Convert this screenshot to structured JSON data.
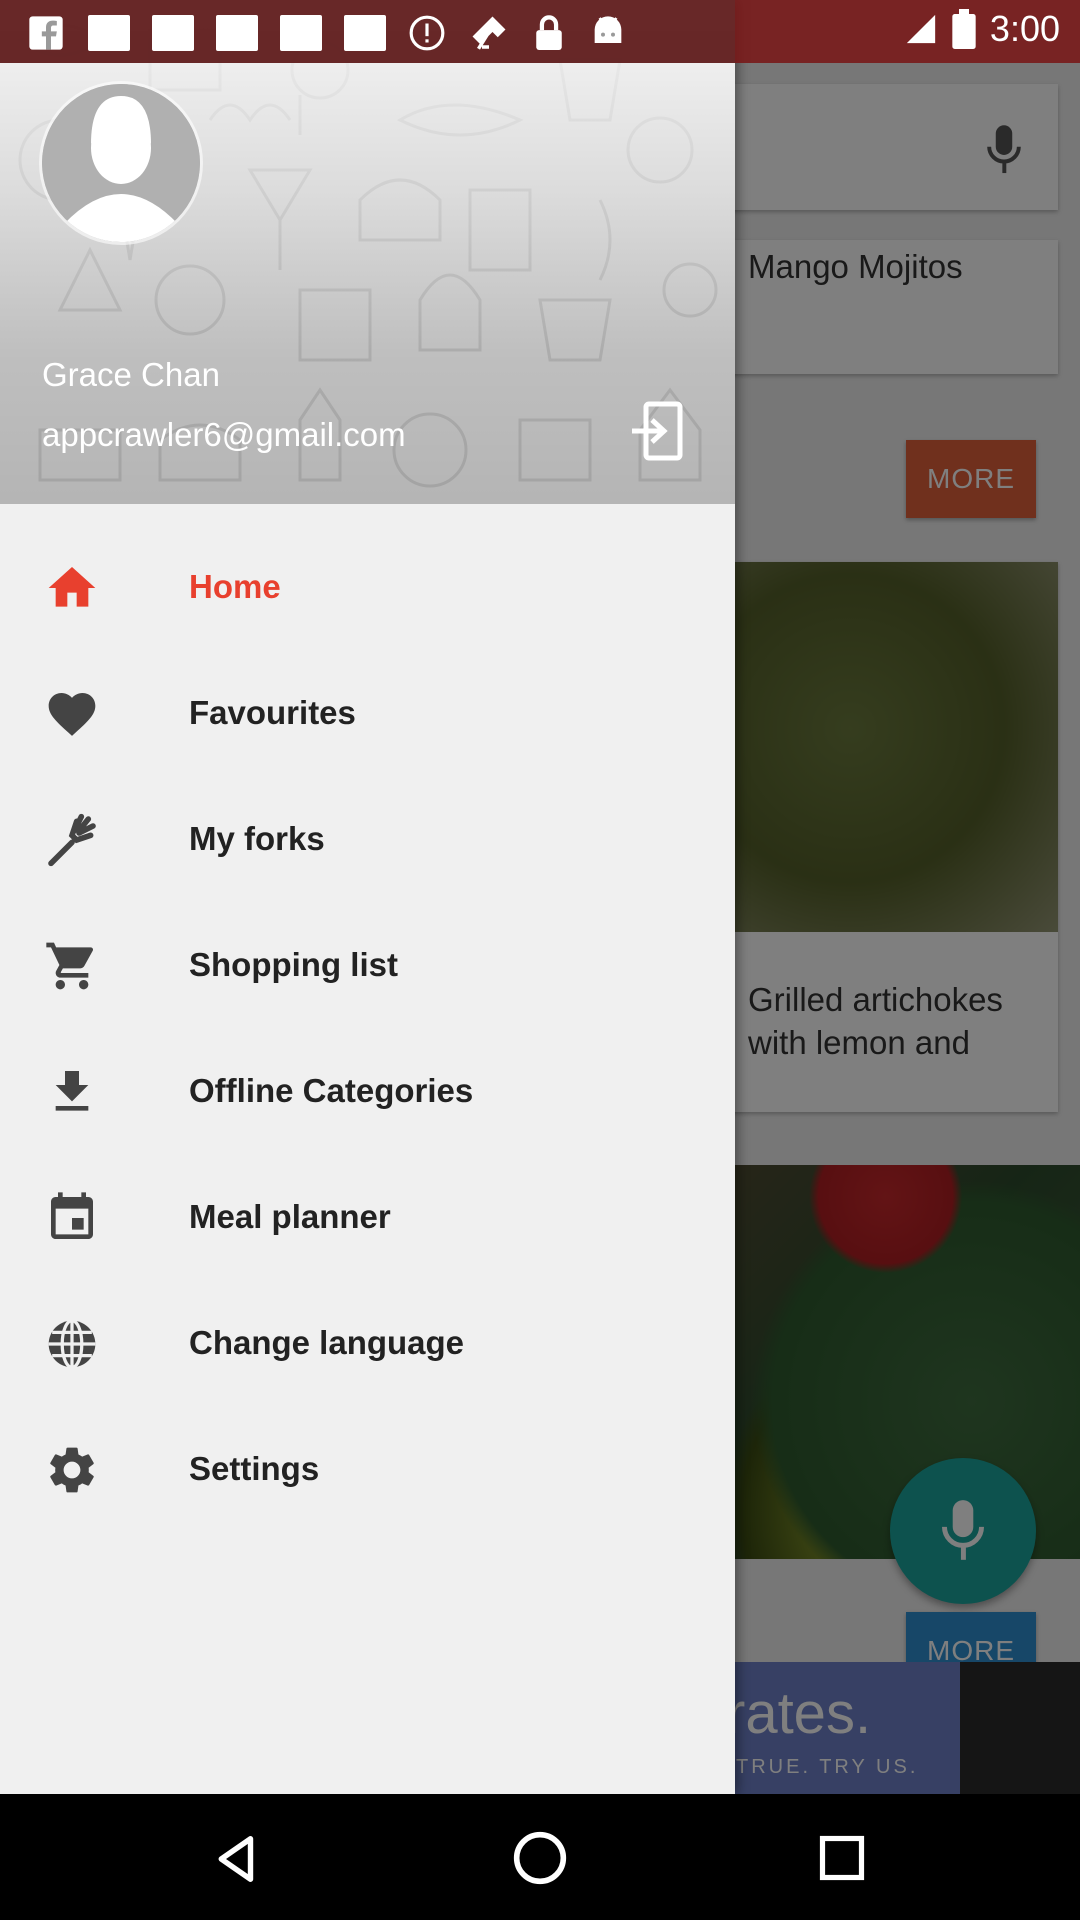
{
  "status_bar": {
    "time": "3:00"
  },
  "background_app": {
    "card_1_title": "Mango Mojitos",
    "more_label": "MORE",
    "card_2_title_line1": "Grilled artichokes",
    "card_2_title_line2": "with lemon and",
    "more_label_2": "MORE",
    "ad_headline": "rates.",
    "ad_tagline": "TRUE. TRY US."
  },
  "drawer": {
    "user": {
      "name": "Grace Chan",
      "email": "appcrawler6@gmail.com"
    },
    "menu": [
      {
        "label": "Home",
        "icon": "home-icon",
        "active": true
      },
      {
        "label": "Favourites",
        "icon": "heart-icon"
      },
      {
        "label": "My forks",
        "icon": "fork-icon"
      },
      {
        "label": "Shopping list",
        "icon": "cart-icon"
      },
      {
        "label": "Offline Categories",
        "icon": "download-icon"
      },
      {
        "label": "Meal planner",
        "icon": "calendar-icon"
      },
      {
        "label": "Change language",
        "icon": "globe-icon"
      },
      {
        "label": "Settings",
        "icon": "gear-icon"
      }
    ]
  },
  "colors": {
    "accent": "#e8402e",
    "icon": "#444444",
    "drawer_bg": "#f0f0f0"
  }
}
